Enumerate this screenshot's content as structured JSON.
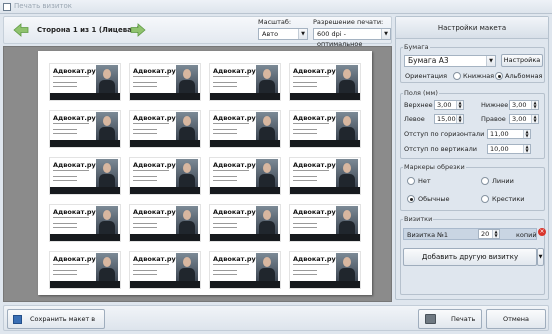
{
  "window": {
    "title": "Печать визиток"
  },
  "toolbar": {
    "page_info": "Сторона 1 из 1 (Лицевая)",
    "scale_label": "Масштаб:",
    "scale_value": "Авто",
    "resolution_label": "Разрешение печати:",
    "resolution_value": "600 dpi - оптимальное"
  },
  "card": {
    "title": "Адвокат.ру"
  },
  "settings": {
    "header": "Настройки макета",
    "paper": {
      "group_title": "Бумага",
      "format_value": "Бумага А3",
      "settings_button": "Настройка",
      "orientation_label": "Ориентация",
      "portrait_label": "Книжная",
      "landscape_label": "Альбомная",
      "selected": "landscape"
    },
    "margins": {
      "group_title": "Поля (мм)",
      "top_label": "Верхнее",
      "top_value": "3,00",
      "bottom_label": "Нижнее",
      "bottom_value": "3,00",
      "left_label": "Левое",
      "left_value": "15,00",
      "right_label": "Правое",
      "right_value": "3,00",
      "hgap_label": "Отступ по горизонтали",
      "hgap_value": "11,00",
      "vgap_label": "Отступ по вертикали",
      "vgap_value": "10,00"
    },
    "crop_marks": {
      "group_title": "Маркеры обрезки",
      "none_label": "Нет",
      "lines_label": "Линии",
      "normal_label": "Обычные",
      "crosses_label": "Крестики",
      "selected": "normal"
    },
    "cards": {
      "group_title": "Визитки",
      "item_label": "Визитка №1",
      "count_value": "20",
      "count_unit": "копий",
      "add_button": "Добавить другую визитку"
    }
  },
  "bottom": {
    "save_button": "Сохранить макет в файл",
    "print_button": "Печать",
    "cancel_button": "Отмена"
  }
}
